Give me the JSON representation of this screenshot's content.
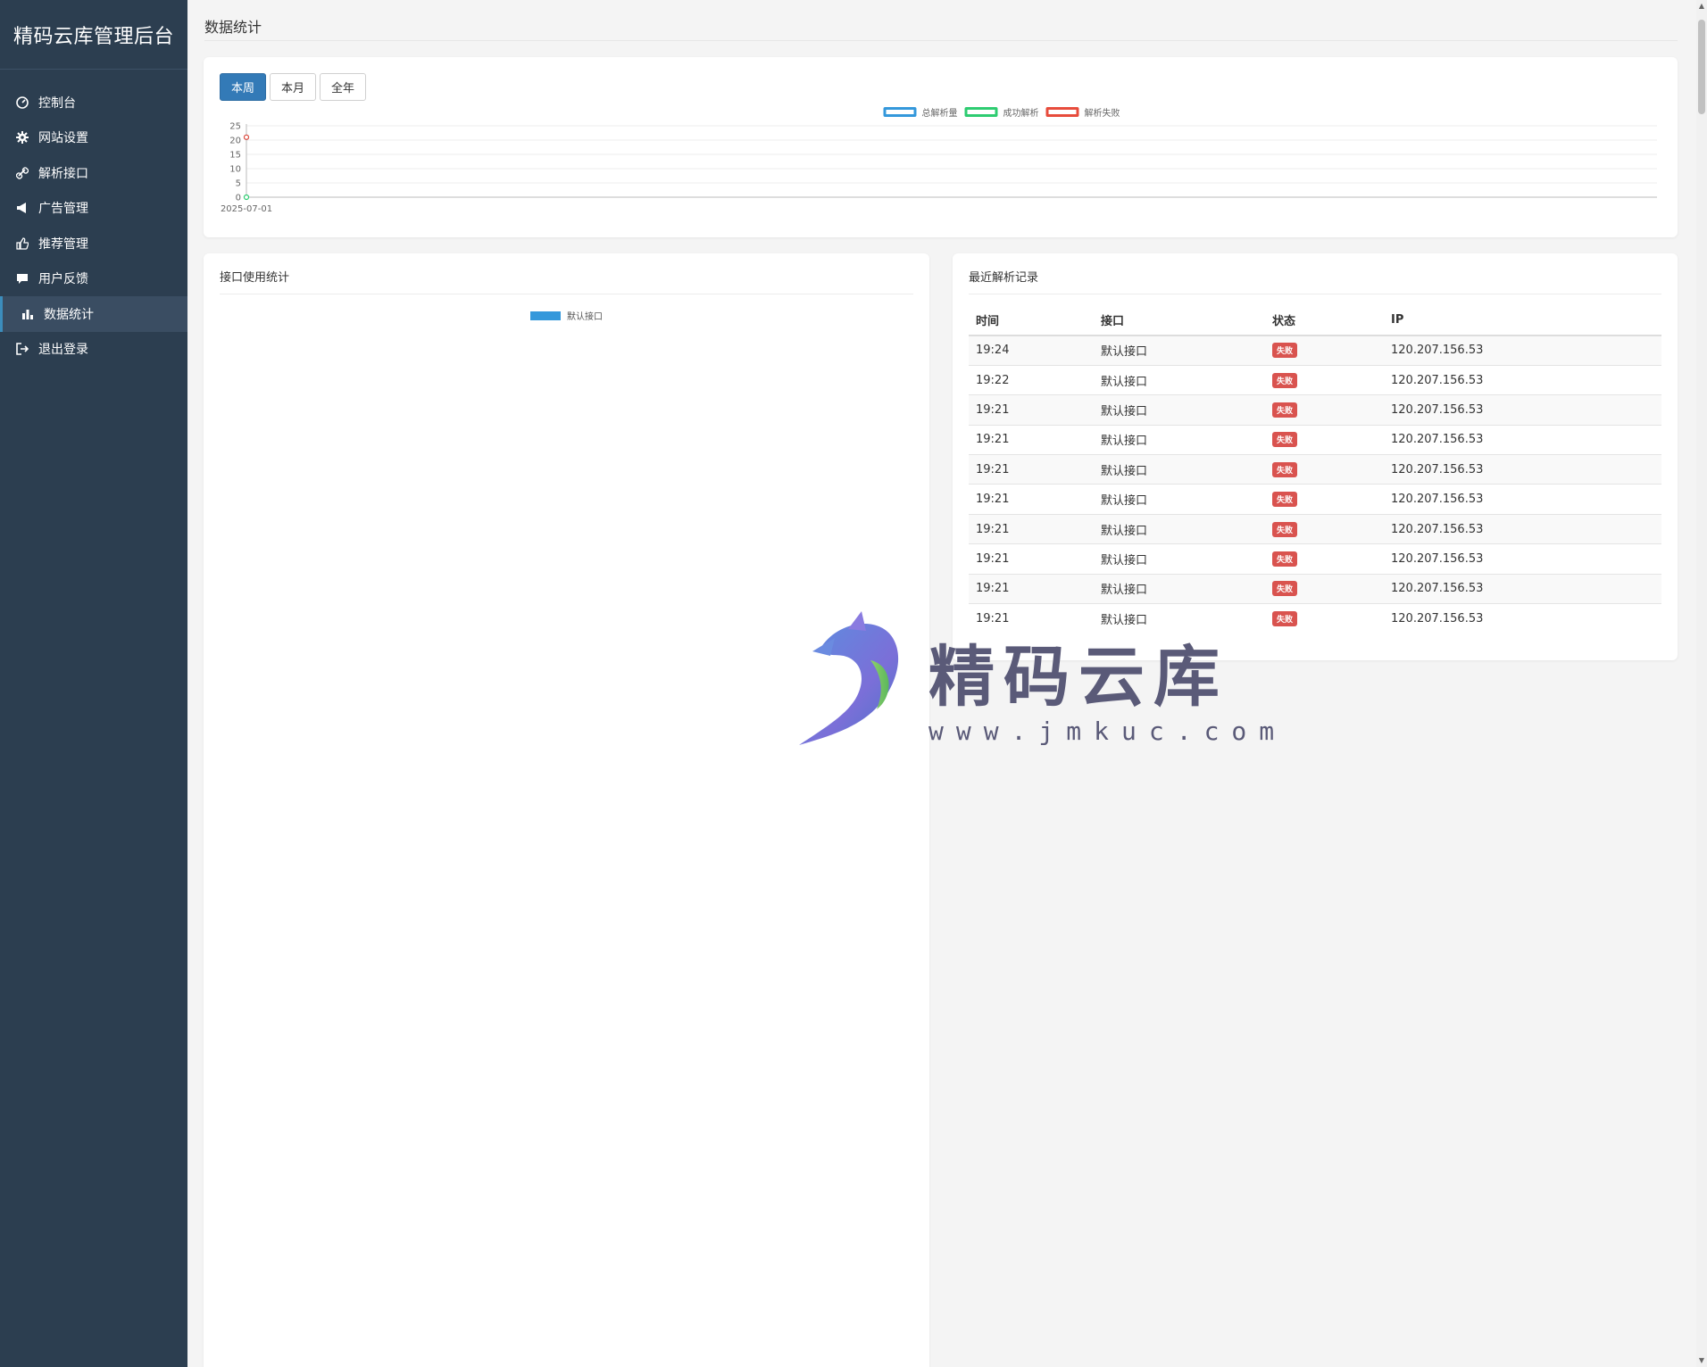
{
  "app": {
    "brand": "精码云库管理后台",
    "page_title": "数据统计"
  },
  "sidebar": {
    "items": [
      {
        "label": "控制台",
        "icon": "dashboard-icon",
        "active": false
      },
      {
        "label": "网站设置",
        "icon": "gear-icon",
        "active": false
      },
      {
        "label": "解析接口",
        "icon": "link-icon",
        "active": false
      },
      {
        "label": "广告管理",
        "icon": "megaphone-icon",
        "active": false
      },
      {
        "label": "推荐管理",
        "icon": "thumbs-up-icon",
        "active": false
      },
      {
        "label": "用户反馈",
        "icon": "comment-icon",
        "active": false
      },
      {
        "label": "数据统计",
        "icon": "bar-chart-icon",
        "active": true
      },
      {
        "label": "退出登录",
        "icon": "sign-out-icon",
        "active": false
      }
    ]
  },
  "period_tabs": [
    {
      "label": "本周",
      "active": true
    },
    {
      "label": "本月",
      "active": false
    },
    {
      "label": "全年",
      "active": false
    }
  ],
  "chart_data": {
    "type": "line",
    "title": "",
    "x": [
      "2025-07-01"
    ],
    "series": [
      {
        "name": "总解析量",
        "values": [
          21
        ],
        "color": "#3498db"
      },
      {
        "name": "成功解析",
        "values": [
          0
        ],
        "color": "#2ecc71"
      },
      {
        "name": "解析失败",
        "values": [
          21
        ],
        "color": "#e74c3c"
      }
    ],
    "y_ticks": [
      "25",
      "20",
      "15",
      "10",
      "5",
      "0"
    ],
    "ylim": [
      0,
      25
    ],
    "grid": true,
    "legend": "top-center"
  },
  "api_stats": {
    "title": "接口使用统计",
    "legend_label": "默认接口",
    "legend_color": "#3498db"
  },
  "recent": {
    "title": "最近解析记录",
    "columns": [
      "时间",
      "接口",
      "状态",
      "IP"
    ],
    "rows": [
      {
        "time": "19:24",
        "api": "默认接口",
        "status": "失败",
        "ip": "120.207.156.53"
      },
      {
        "time": "19:22",
        "api": "默认接口",
        "status": "失败",
        "ip": "120.207.156.53"
      },
      {
        "time": "19:21",
        "api": "默认接口",
        "status": "失败",
        "ip": "120.207.156.53"
      },
      {
        "time": "19:21",
        "api": "默认接口",
        "status": "失败",
        "ip": "120.207.156.53"
      },
      {
        "time": "19:21",
        "api": "默认接口",
        "status": "失败",
        "ip": "120.207.156.53"
      },
      {
        "time": "19:21",
        "api": "默认接口",
        "status": "失败",
        "ip": "120.207.156.53"
      },
      {
        "time": "19:21",
        "api": "默认接口",
        "status": "失败",
        "ip": "120.207.156.53"
      },
      {
        "time": "19:21",
        "api": "默认接口",
        "status": "失败",
        "ip": "120.207.156.53"
      },
      {
        "time": "19:21",
        "api": "默认接口",
        "status": "失败",
        "ip": "120.207.156.53"
      },
      {
        "time": "19:21",
        "api": "默认接口",
        "status": "失败",
        "ip": "120.207.156.53"
      }
    ],
    "fail_color": "#d9534f"
  },
  "watermark": {
    "text": "精码云库",
    "url": "www.jmkuc.com"
  }
}
